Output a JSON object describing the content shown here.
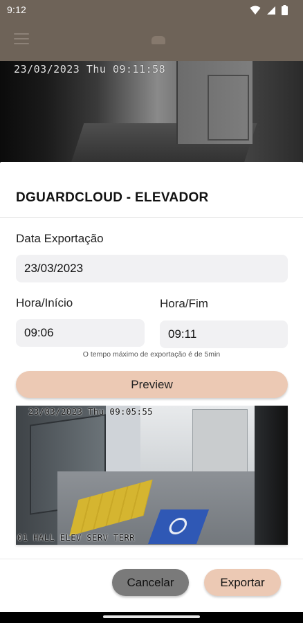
{
  "status_bar": {
    "time": "9:12",
    "icons": [
      "wifi-icon",
      "signal-icon",
      "battery-icon"
    ]
  },
  "app_bar": {
    "icons": [
      "menu-icon",
      "app-logo"
    ]
  },
  "camera_background": {
    "timestamp": "23/03/2023 Thu 09:11:58"
  },
  "sheet": {
    "title": "DGUARDCLOUD - ELEVADOR",
    "date_label": "Data Exportação",
    "date_value": "23/03/2023",
    "start_label": "Hora/Início",
    "start_value": "09:06",
    "end_label": "Hora/Fim",
    "end_value": "09:11",
    "hint": "O tempo máximo de exportação é de 5min",
    "preview_button": "Preview",
    "preview_image": {
      "timestamp": "23/03/2023 Thu 09:05:55",
      "caption": "01 HALL ELEV SERV TERR"
    },
    "cancel_button": "Cancelar",
    "export_button": "Exportar"
  },
  "colors": {
    "app_bar": "#6e6358",
    "accent_button": "#ecc9b4",
    "cancel_button": "#7a7a7a",
    "field_bg": "#f1f1f3"
  }
}
